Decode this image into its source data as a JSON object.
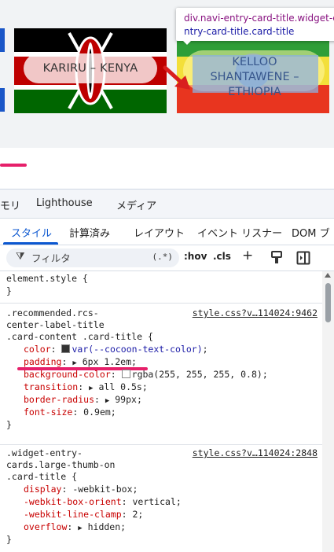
{
  "preview": {
    "card1_label": "KARIRU – KENYA",
    "card2_label": "KELLOO SHANTAWENE – ETHIOPIA",
    "tooltip_line1": "div.navi-entry-card-title.widget-e",
    "tooltip_line2": "ntry-card-title.card-title"
  },
  "devtools": {
    "panel_tabs": [
      "モリ",
      "Lighthouse",
      "メディア"
    ],
    "sub_tabs": [
      "スタイル",
      "計算済み",
      "レイアウト",
      "イベント リスナー",
      "DOM ブ"
    ],
    "filter_placeholder": "フィルタ",
    "filter_tokens": [
      "(.*)",
      ":hov",
      ".cls",
      "+"
    ],
    "element_style": {
      "selector": "element.style {",
      "close": "}"
    },
    "rule1": {
      "selector": [
        ".recommended.rcs-",
        "center-label-title",
        ".card-content .card-title {"
      ],
      "source": "style.css?v…114024:9462",
      "declarations": [
        {
          "prop": "color",
          "value": "var(--cocoon-text-color)"
        },
        {
          "prop": "padding",
          "value": "6px 1.2em"
        },
        {
          "prop": "background-color",
          "value": "rgba(255, 255, 255, 0.8)"
        },
        {
          "prop": "transition",
          "value": "all 0.5s"
        },
        {
          "prop": "border-radius",
          "value": "99px"
        },
        {
          "prop": "font-size",
          "value": "0.9em"
        }
      ],
      "close": "}"
    },
    "rule2": {
      "selector": [
        ".widget-entry-",
        "cards.large-thumb-on",
        ".card-title {"
      ],
      "source": "style.css?v…114024:2848",
      "declarations": [
        {
          "prop": "display",
          "value": "-webkit-box"
        },
        {
          "prop": "-webkit-box-orient",
          "value": "vertical"
        },
        {
          "prop": "-webkit-line-clamp",
          "value": "2"
        },
        {
          "prop": "overflow",
          "value": "hidden"
        }
      ],
      "close": "}"
    }
  },
  "colors": {
    "kenya_black": "#000000",
    "kenya_red": "#be0000",
    "kenya_green": "#006600",
    "accent_blue": "#0b57d0",
    "highlight_pink": "#e6206a",
    "css_property_red": "#c80000"
  }
}
